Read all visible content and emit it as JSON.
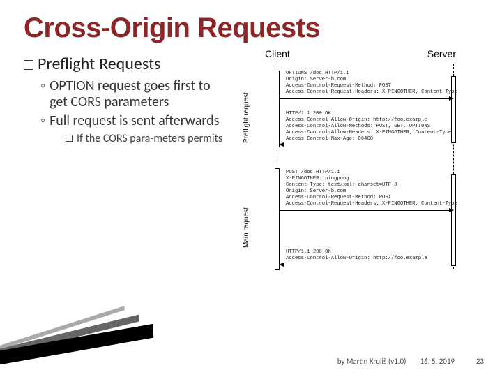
{
  "title": "Cross-Origin Requests",
  "heading": {
    "keyword": "Preflight",
    "rest": "Requests"
  },
  "bullets": {
    "b1": "OPTION request goes first to get CORS parameters",
    "b2": "Full request is sent afterwards",
    "b2a": "If the CORS para-meters permits"
  },
  "diagram": {
    "client": "Client",
    "server": "Server",
    "preflight_label": "Preflight request",
    "main_label": "Main request",
    "req1": "OPTIONS /doc HTTP/1.1\nOrigin: Server-b.com\nAccess-Control-Request-Method: POST\nAccess-Control-Request-Headers: X-PINGOTHER, Content-Type",
    "res1": "HTTP/1.1 200 OK\nAccess-Control-Allow-Origin: http://foo.example\nAccess-Control-Allow-Methods: POST, GET, OPTIONS\nAccess-Control-Allow-Headers: X-PINGOTHER, Content-Type\nAccess-Control-Max-Age: 86400",
    "req2": "POST /doc HTTP/1.1\nX-PINGOTHER: pingpong\nContent-Type: text/xml; charset=UTF-8\nOrigin: Server-b.com\nAccess-Control-Request-Method: POST\nAccess-Control-Request-Headers: X-PINGOTHER, Content-Type",
    "res2": "HTTP/1.1 200 OK\nAccess-Control-Allow-Origin: http://foo.example"
  },
  "footer": {
    "by": "by Martin Kruliš (v1.0)",
    "date": "16. 5. 2019",
    "page": "23"
  }
}
